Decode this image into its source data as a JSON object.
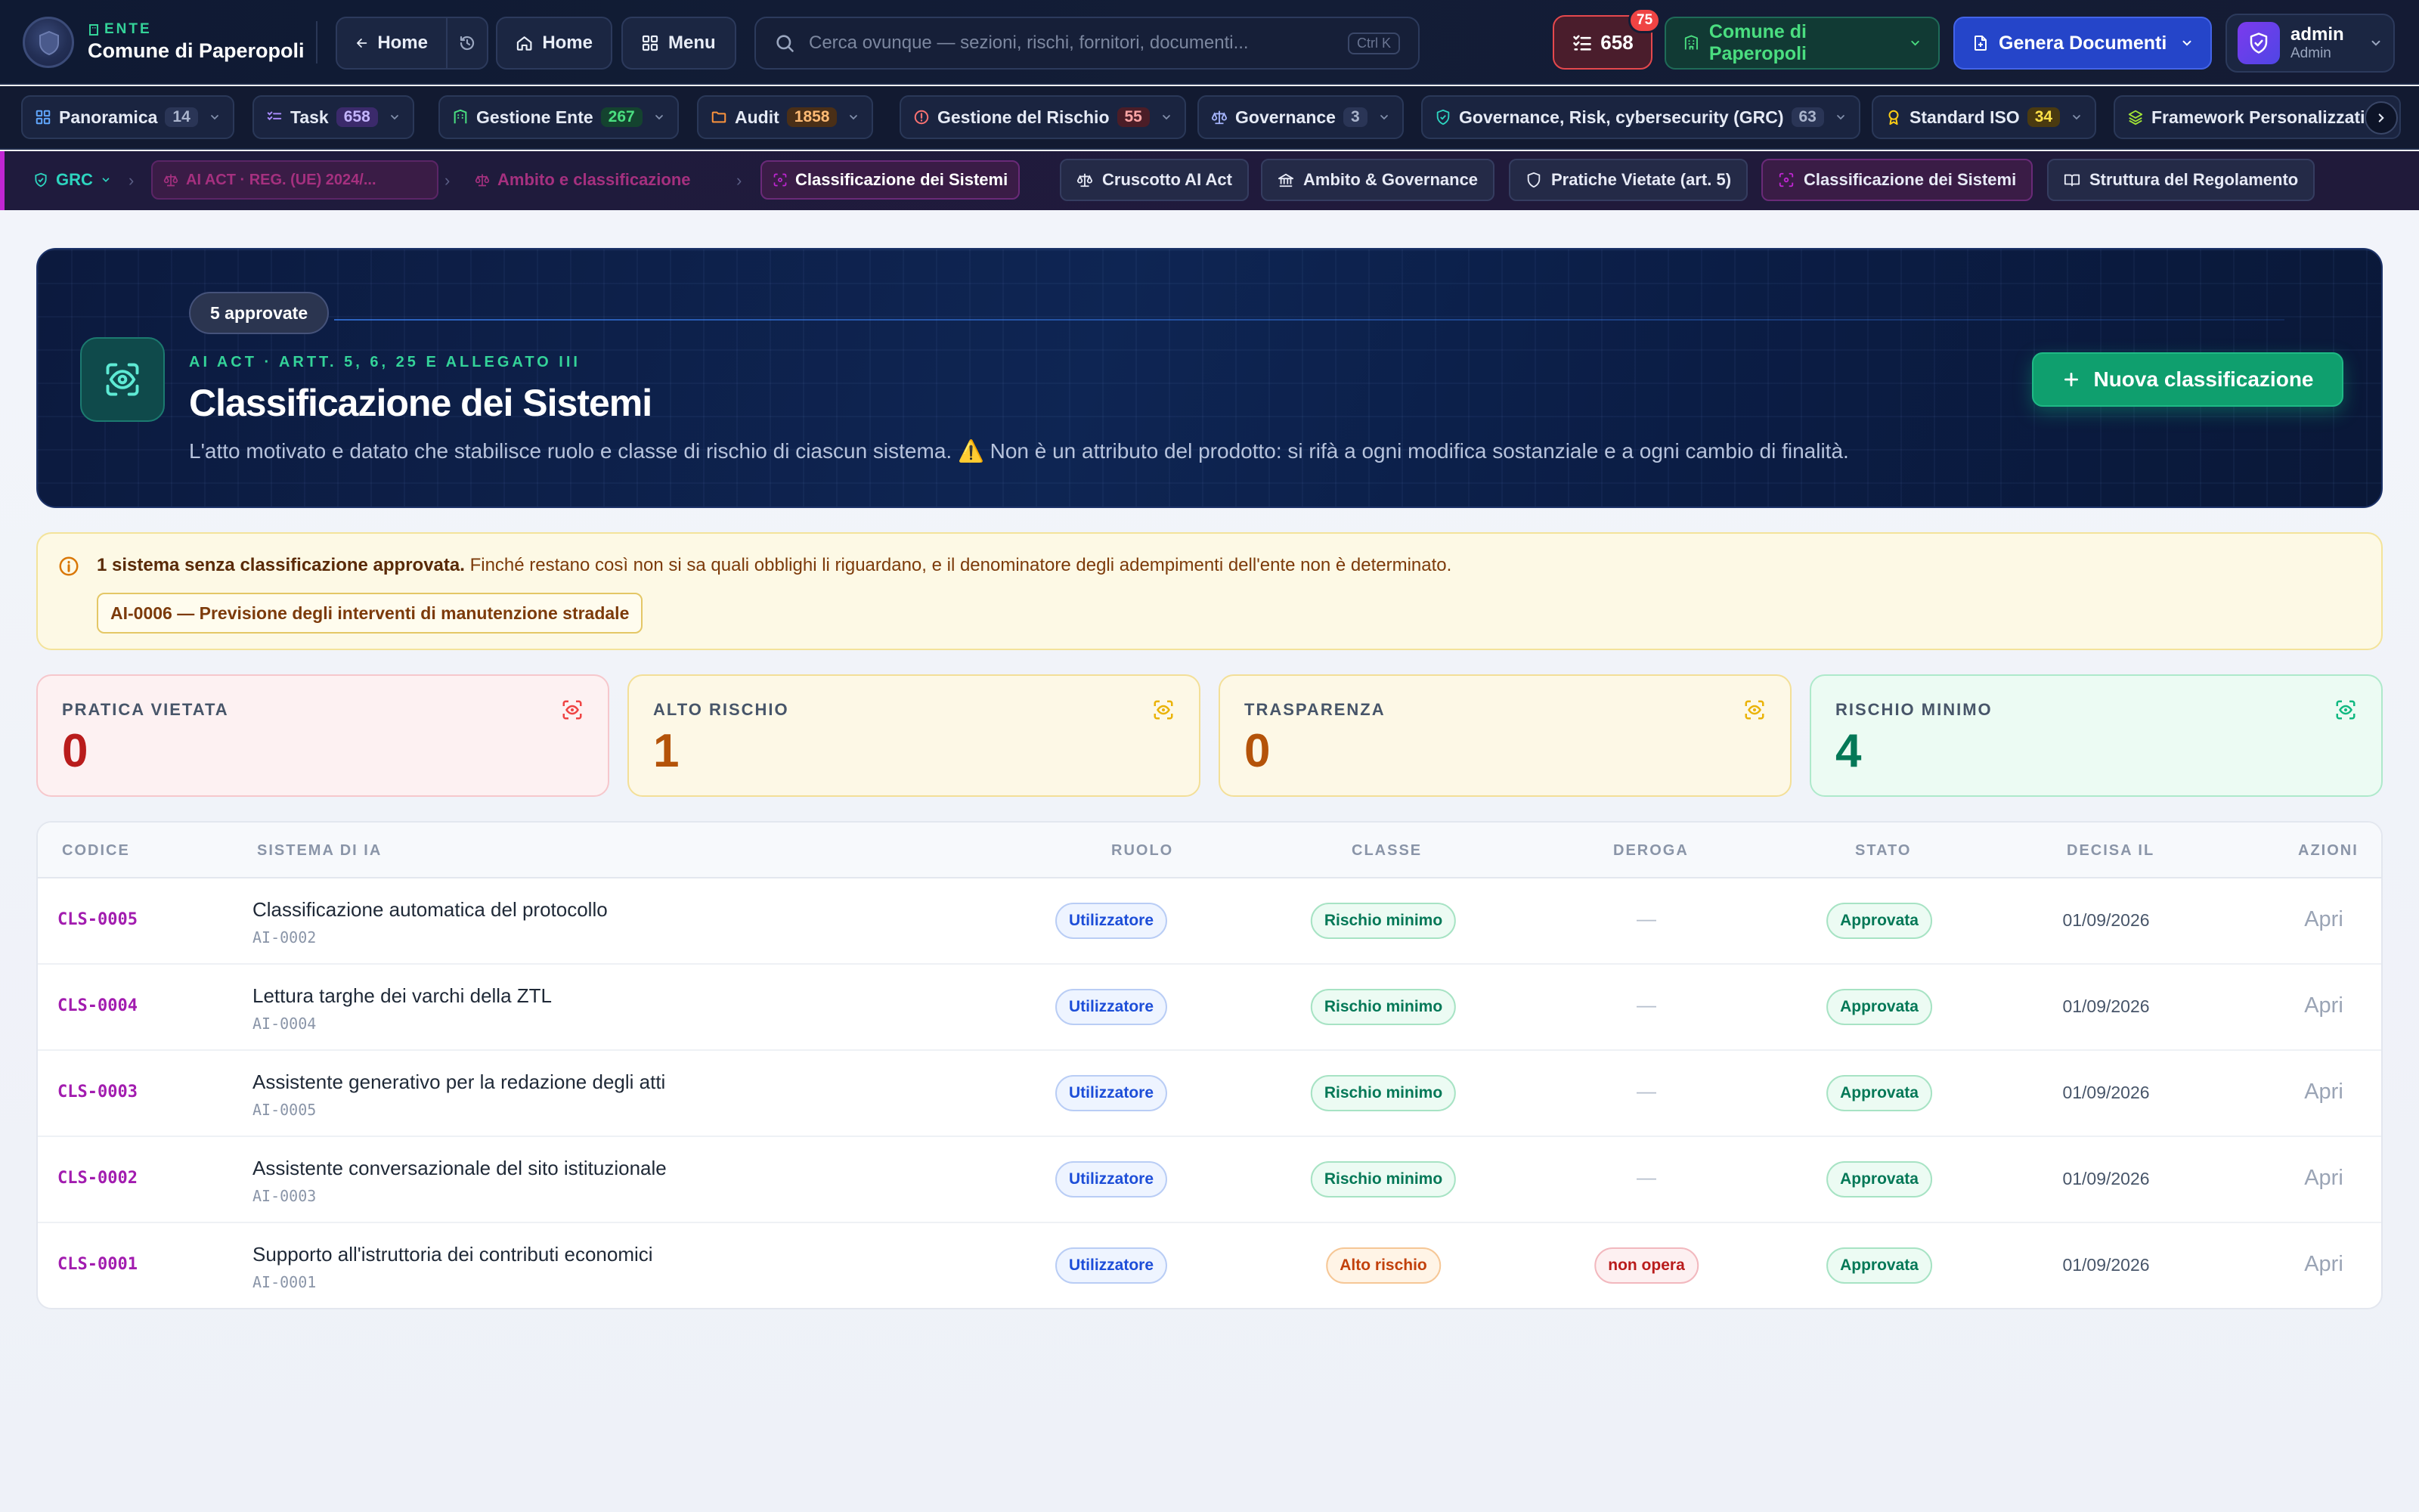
{
  "header": {
    "ente_kicker": "ENTE",
    "ente_name": "Comune di Paperopoli",
    "back_label": "Home",
    "home_label": "Home",
    "menu_label": "Menu",
    "search_placeholder": "Cerca ovunque — sezioni, rischi, fornitori, documenti...",
    "search_shortcut": "Ctrl K",
    "tasks_count": "658",
    "notifications": "75",
    "ente_selector": "Comune di Paperopoli",
    "generate_label": "Genera Documenti",
    "user_name": "admin",
    "user_role": "Admin"
  },
  "modules": [
    {
      "label": "Panoramica",
      "count": "14"
    },
    {
      "label": "Task",
      "count": "658"
    },
    {
      "label": "Gestione Ente",
      "count": "267"
    },
    {
      "label": "Audit",
      "count": "1858"
    },
    {
      "label": "Gestione del Rischio",
      "count": "55"
    },
    {
      "label": "Governance",
      "count": "3"
    },
    {
      "label": "Governance, Risk, cybersecurity (GRC)",
      "count": "63"
    },
    {
      "label": "Standard ISO",
      "count": "34"
    },
    {
      "label": "Framework Personalizzati",
      "count": ""
    }
  ],
  "breadcrumb": {
    "root": "GRC",
    "level1": "AI ACT · REG. (UE) 2024/...",
    "level2": "Ambito e classificazione",
    "current": "Classificazione dei Sistemi"
  },
  "subtabs": [
    {
      "label": "Cruscotto AI Act"
    },
    {
      "label": "Ambito & Governance"
    },
    {
      "label": "Pratiche Vietate (art. 5)"
    },
    {
      "label": "Classificazione dei Sistemi"
    },
    {
      "label": "Struttura del Regolamento"
    }
  ],
  "hero": {
    "approved_chip": "5 approvate",
    "kicker": "AI ACT · ARTT. 5, 6, 25 E ALLEGATO III",
    "title": "Classificazione dei Sistemi",
    "description": "L'atto motivato e datato che stabilisce ruolo e classe di rischio di ciascun sistema. ⚠️ Non è un attributo del prodotto: si rifà a ogni modifica sostanziale e a ogni cambio di finalità.",
    "new_button": "Nuova classificazione"
  },
  "warning": {
    "bold": "1 sistema senza classificazione approvata.",
    "text": "Finché restano così non si sa quali obblighi li riguardano, e il denominatore degli adempimenti dell'ente non è determinato.",
    "chip": "AI-0006 — Previsione degli interventi di manutenzione stradale"
  },
  "stats": [
    {
      "label": "PRATICA VIETATA",
      "value": "0",
      "color": "#b91c1c"
    },
    {
      "label": "ALTO RISCHIO",
      "value": "1",
      "color": "#b45309"
    },
    {
      "label": "TRASPARENZA",
      "value": "0",
      "color": "#b45309"
    },
    {
      "label": "RISCHIO MINIMO",
      "value": "4",
      "color": "#047857"
    }
  ],
  "table": {
    "headers": {
      "code": "CODICE",
      "system": "SISTEMA DI IA",
      "role": "RUOLO",
      "class": "CLASSE",
      "derogation": "DEROGA",
      "status": "STATO",
      "decided": "DECISA IL",
      "actions": "AZIONI"
    },
    "rows": [
      {
        "code": "CLS-0005",
        "name": "Classificazione automatica del protocollo",
        "system_code": "AI-0002",
        "role": "Utilizzatore",
        "class": "Rischio minimo",
        "derogation": "—",
        "status": "Approvata",
        "decided": "01/09/2026",
        "action": "Apri"
      },
      {
        "code": "CLS-0004",
        "name": "Lettura targhe dei varchi della ZTL",
        "system_code": "AI-0004",
        "role": "Utilizzatore",
        "class": "Rischio minimo",
        "derogation": "—",
        "status": "Approvata",
        "decided": "01/09/2026",
        "action": "Apri"
      },
      {
        "code": "CLS-0003",
        "name": "Assistente generativo per la redazione degli atti",
        "system_code": "AI-0005",
        "role": "Utilizzatore",
        "class": "Rischio minimo",
        "derogation": "—",
        "status": "Approvata",
        "decided": "01/09/2026",
        "action": "Apri"
      },
      {
        "code": "CLS-0002",
        "name": "Assistente conversazionale del sito istituzionale",
        "system_code": "AI-0003",
        "role": "Utilizzatore",
        "class": "Rischio minimo",
        "derogation": "—",
        "status": "Approvata",
        "decided": "01/09/2026",
        "action": "Apri"
      },
      {
        "code": "CLS-0001",
        "name": "Supporto all'istruttoria dei contributi economici",
        "system_code": "AI-0001",
        "role": "Utilizzatore",
        "class": "Alto rischio",
        "derogation": "non opera",
        "status": "Approvata",
        "decided": "01/09/2026",
        "action": "Apri"
      }
    ]
  }
}
